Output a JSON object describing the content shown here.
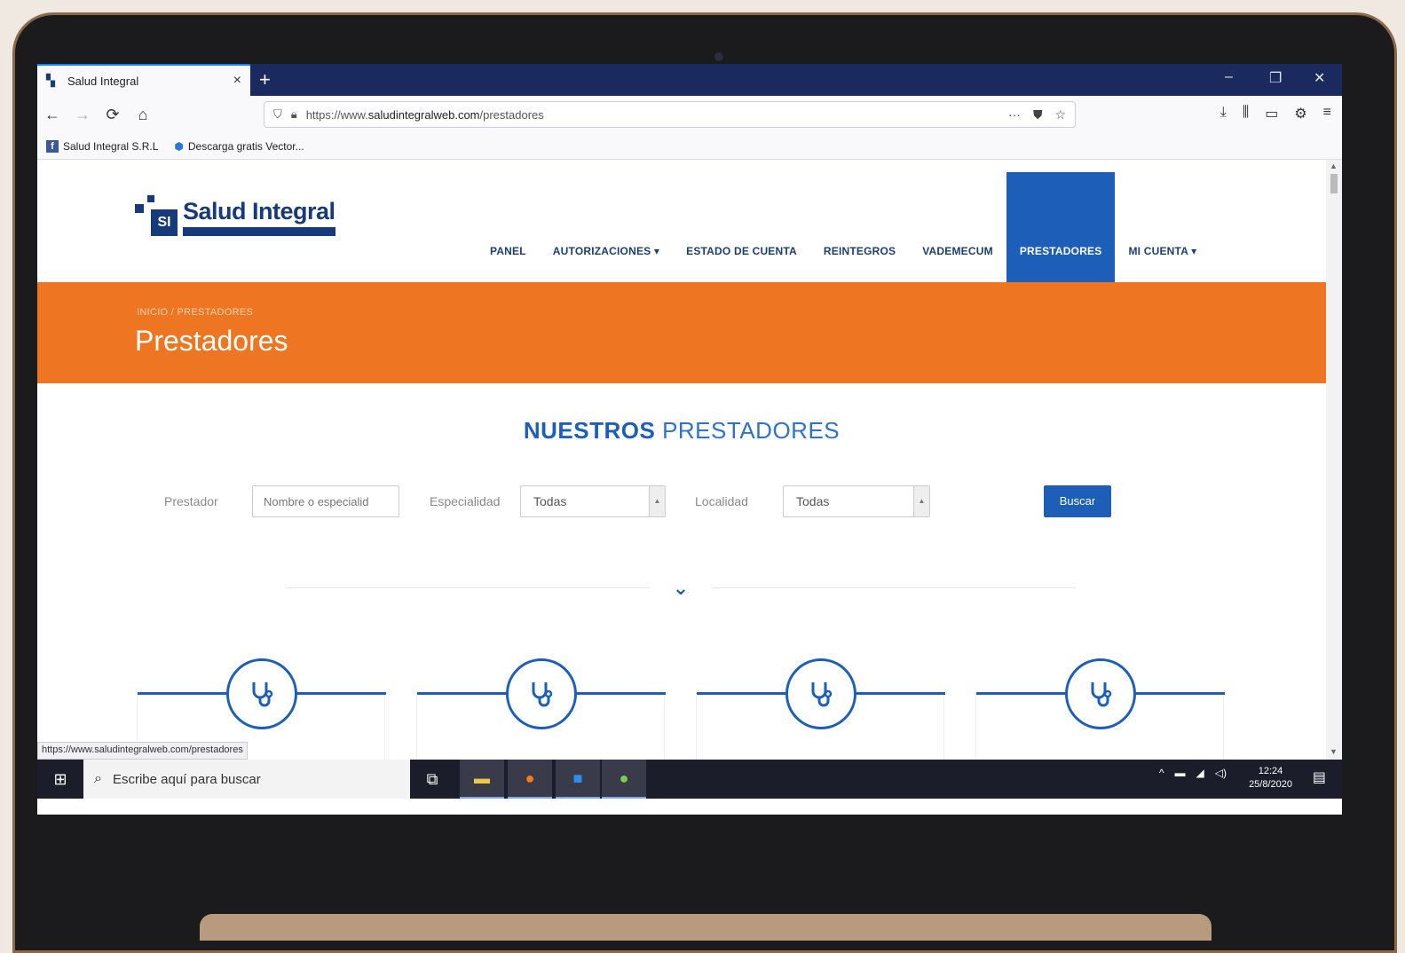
{
  "browser": {
    "tab_title": "Salud Integral",
    "tab_close": "×",
    "new_tab": "+",
    "window_controls": {
      "minimize": "–",
      "restore": "❐",
      "close": "✕"
    },
    "url_prefix": "https://www.",
    "url_domain": "saludintegralweb.com",
    "url_path": "/prestadores",
    "bookmarks": [
      {
        "label": "Salud Integral S.R.L"
      },
      {
        "label": "Descarga gratis Vector..."
      }
    ],
    "status_url": "https://www.saludintegralweb.com/prestadores"
  },
  "site": {
    "logo_name": "Salud Integral",
    "logo_mark": "SI",
    "nav": [
      {
        "label": "PANEL"
      },
      {
        "label": "AUTORIZACIONES ▾"
      },
      {
        "label": "ESTADO DE CUENTA"
      },
      {
        "label": "REINTEGROS"
      },
      {
        "label": "VADEMECUM"
      },
      {
        "label": "PRESTADORES"
      },
      {
        "label": "MI CUENTA ▾"
      }
    ],
    "breadcrumb": "INICIO  /  PRESTADORES",
    "page_title": "Prestadores",
    "section_title_bold": "NUESTROS",
    "section_title_rest": " PRESTADORES",
    "filters": {
      "prestador_label": "Prestador",
      "prestador_placeholder": "Nombre o especialid",
      "especialidad_label": "Especialidad",
      "especialidad_value": "Todas",
      "localidad_label": "Localidad",
      "localidad_value": "Todas",
      "search_button": "Buscar"
    },
    "accent_color": "#1d5fb8",
    "banner_color": "#ee7622"
  },
  "taskbar": {
    "search_placeholder": "Escribe aquí para buscar",
    "time": "12:24",
    "date": "25/8/2020"
  }
}
